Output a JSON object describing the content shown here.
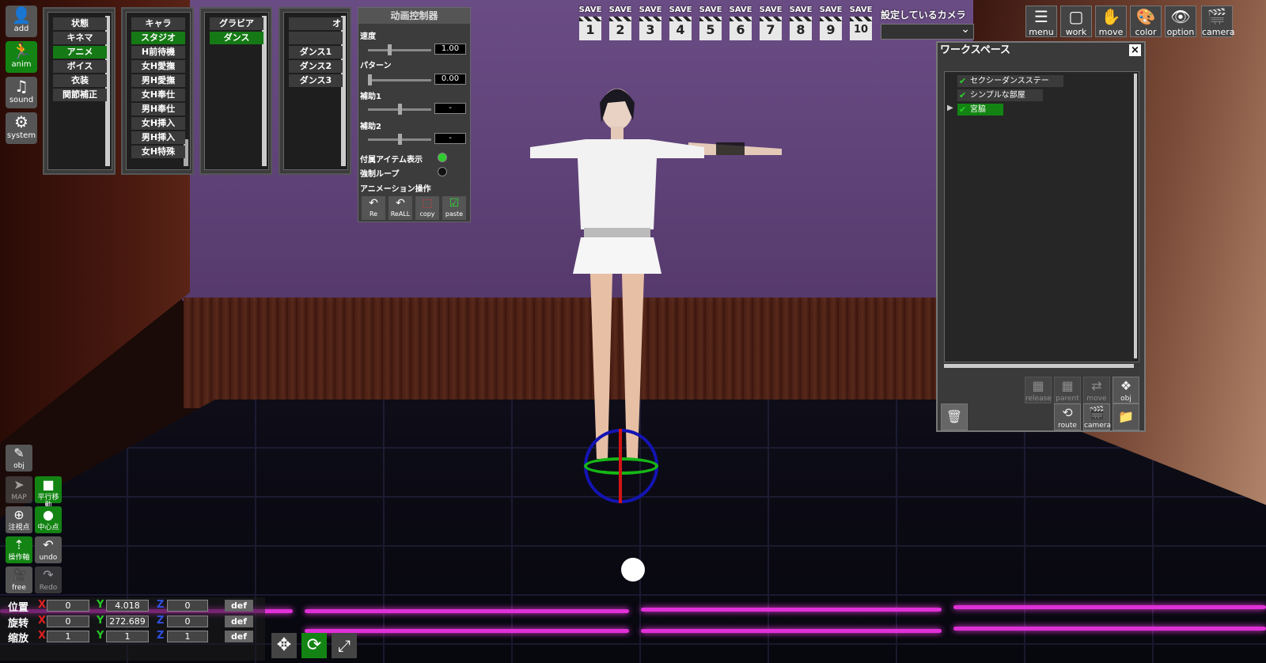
{
  "left_nav": {
    "add": "add",
    "anim": "anim",
    "sound": "sound",
    "system": "system"
  },
  "category_col1": [
    "状態",
    "キネマ",
    "アニメ",
    "ボイス",
    "衣装",
    "関節補正"
  ],
  "category_col1_selected": 2,
  "category_col2": [
    "キャラ",
    "スタジオ",
    "H前待機",
    "女H愛撫",
    "男H愛撫",
    "女H奉仕",
    "男H奉仕",
    "女H挿入",
    "男H挿入",
    "女H特殊"
  ],
  "category_col2_selected": 1,
  "category_col3": [
    "グラビア",
    "ダンス"
  ],
  "category_col3_selected": 1,
  "category_col4": [
    "オ",
    "",
    "ダンス1",
    "ダンス2",
    "ダンス3"
  ],
  "anim_panel": {
    "title": "动画控制器",
    "speed_label": "速度",
    "speed_value": "1.00",
    "speed_level": 0.33,
    "pattern_label": "パターン",
    "pattern_value": "0.00",
    "pattern_level": 0.0,
    "aux1_label": "補助1",
    "aux1_value": "-",
    "aux2_label": "補助2",
    "aux2_value": "-",
    "accessory_label": "付属アイテム表示",
    "accessory_on": true,
    "loop_label": "強制ループ",
    "loop_on": false,
    "ops_label": "アニメーション操作",
    "ops": [
      "Re",
      "ReALL",
      "copy",
      "paste"
    ]
  },
  "save_slots": {
    "label": "SAVE",
    "numbers": [
      "1",
      "2",
      "3",
      "4",
      "5",
      "6",
      "7",
      "8",
      "9",
      "10"
    ]
  },
  "camera_select": {
    "label": "設定しているカメラ",
    "value": ""
  },
  "toolbar": [
    "menu",
    "work",
    "move",
    "color",
    "option",
    "camera"
  ],
  "workspace": {
    "title": "ワークスペース",
    "items": [
      "セクシーダンスステー",
      "シンプルな部屋",
      "宮脇"
    ],
    "selected": 2,
    "buttons_row1": [
      "release",
      "parent",
      "move copy",
      "obj copy"
    ],
    "buttons_row2": [
      "route",
      "camera"
    ]
  },
  "left_tools": {
    "obj": "obj",
    "map": "MAP",
    "parallel": "平行移動",
    "gaze": "注視点",
    "center": "中心点",
    "operate": "操作軸",
    "undo": "undo",
    "free": "free",
    "redo": "Redo"
  },
  "transform": {
    "position_label": "位置",
    "rotation_label": "旋转",
    "scale_label": "缩放",
    "x": "X",
    "y": "Y",
    "z": "Z",
    "position": [
      "0",
      "4.018",
      "0"
    ],
    "rotation": [
      "0",
      "272.689",
      "0"
    ],
    "scale": [
      "1",
      "1",
      "1"
    ],
    "def": "def"
  },
  "colors": {
    "accent_green": "#138413",
    "panel_bg": "#3c3c3c",
    "neon": "#e030d8"
  }
}
